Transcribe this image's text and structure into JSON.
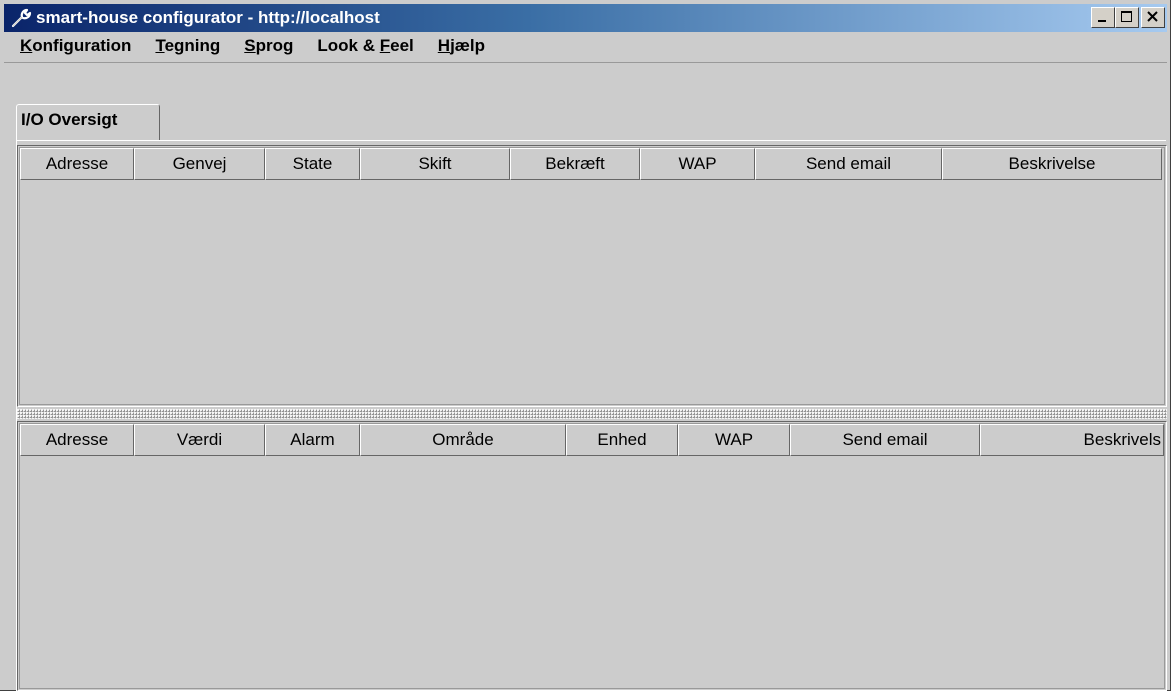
{
  "window": {
    "title": "smart-house configurator - http://localhost",
    "app_icon": "wrench-icon",
    "controls": [
      "minimize-icon",
      "maximize-icon",
      "close-icon"
    ],
    "title_gradient": [
      "#0a246a",
      "#a6caf0"
    ]
  },
  "menu": {
    "items": [
      {
        "mnemonic": "K",
        "rest": "onfiguration"
      },
      {
        "mnemonic": "T",
        "rest": "egning"
      },
      {
        "mnemonic": "S",
        "rest": "prog"
      },
      {
        "pre": "Look & ",
        "mnemonic": "F",
        "rest": "eel"
      },
      {
        "mnemonic": "H",
        "rest": "jælp"
      }
    ]
  },
  "tabs": [
    {
      "label": "I/O Oversigt",
      "selected": true
    }
  ],
  "tables": {
    "top": {
      "columns": [
        "Adresse",
        "Genvej",
        "State",
        "Skift",
        "Bekræft",
        "WAP",
        "Send email",
        "Beskrivelse"
      ],
      "rows": []
    },
    "bottom": {
      "columns": [
        "Adresse",
        "Værdi",
        "Alarm",
        "Område",
        "Enhed",
        "WAP",
        "Send email",
        "Beskrivels"
      ],
      "rows": []
    }
  }
}
